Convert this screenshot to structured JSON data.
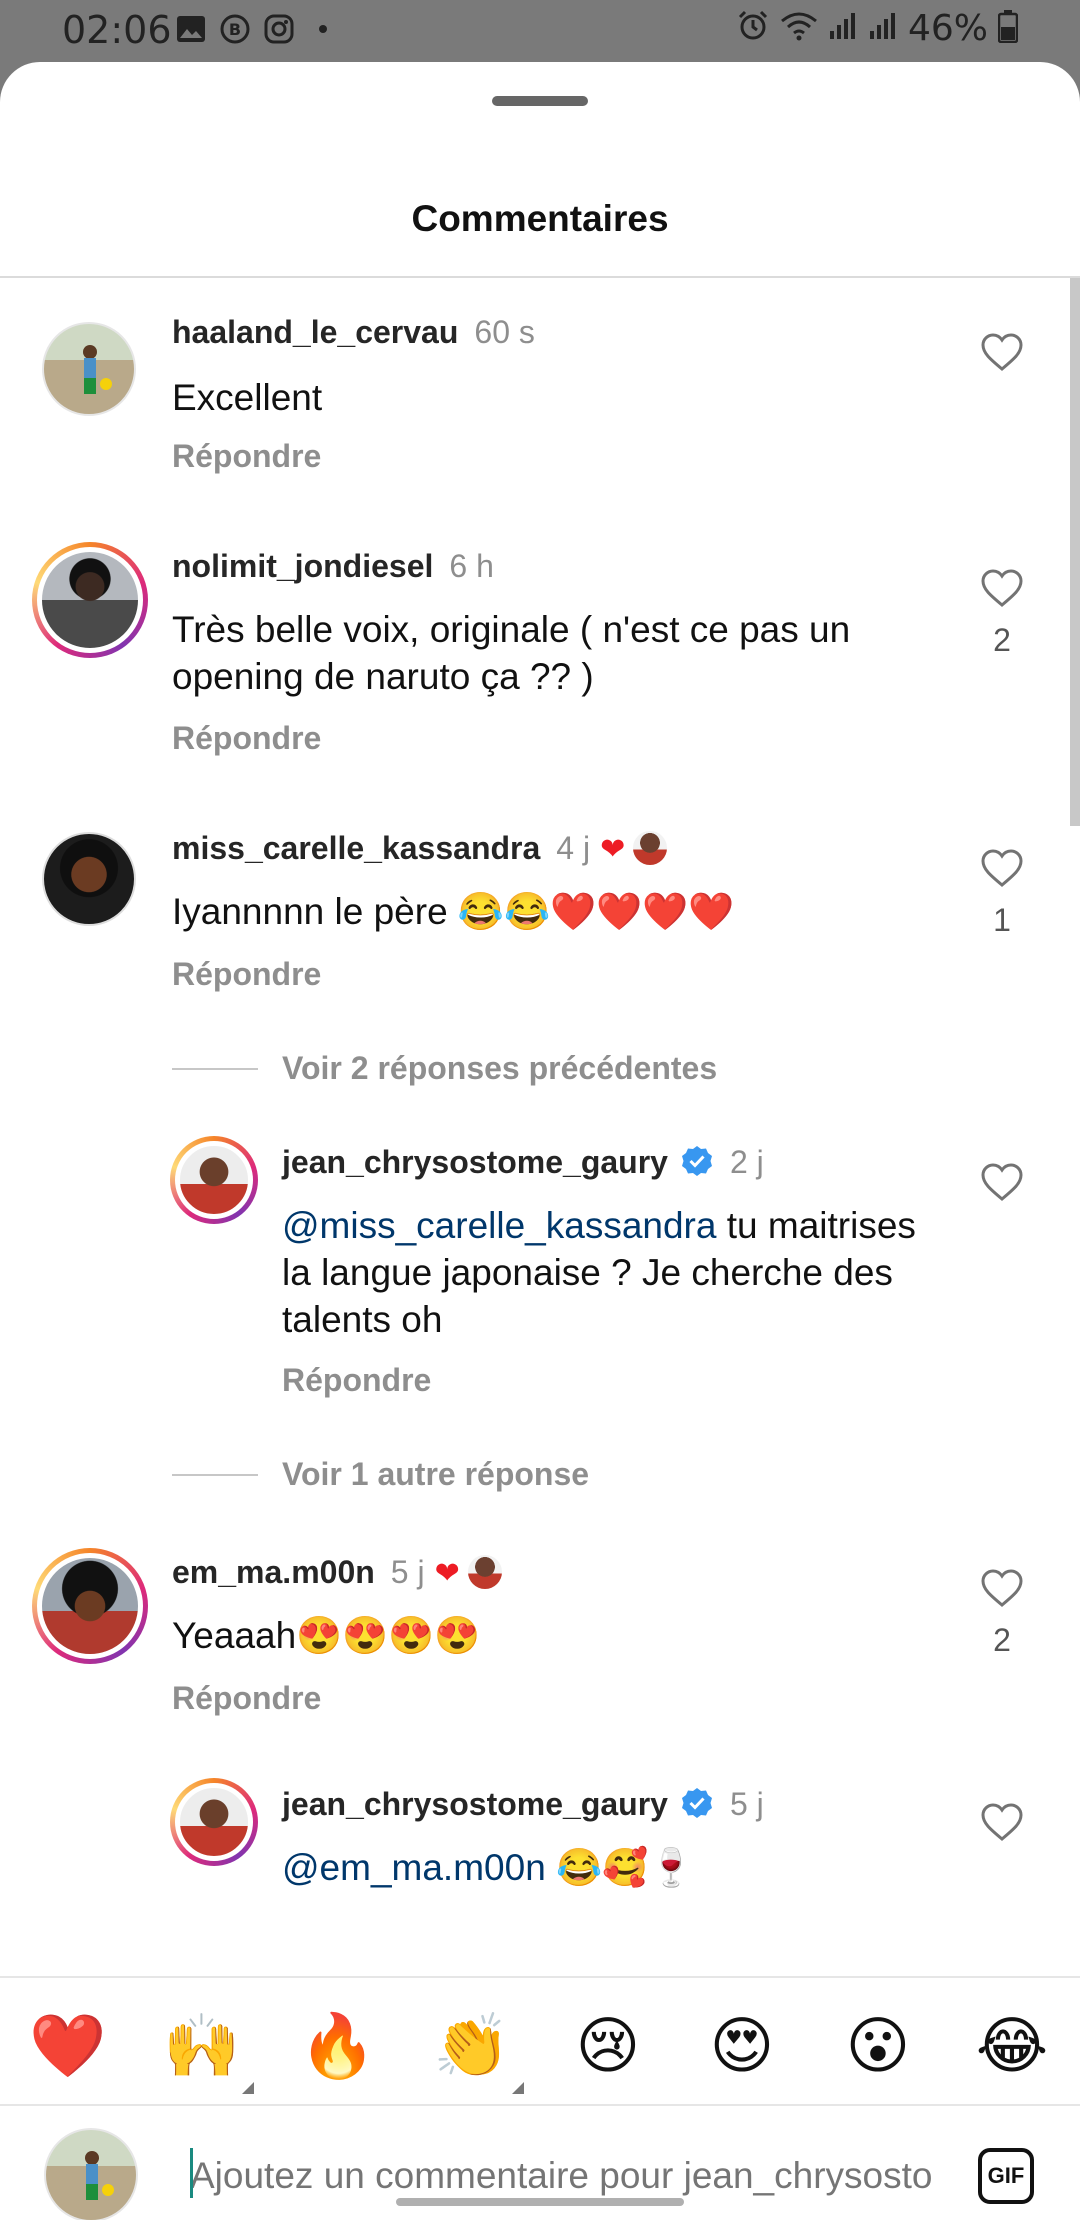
{
  "status_bar": {
    "time": "02:06",
    "battery": "46%",
    "left_icons": [
      "gallery-icon",
      "b-circle-icon",
      "instagram-icon",
      "dot-icon"
    ],
    "right_icons": [
      "alarm-icon",
      "wifi-icon",
      "signal-icon",
      "signal-icon",
      "battery-icon"
    ]
  },
  "sheet": {
    "title": "Commentaires"
  },
  "comments": [
    {
      "username": "haaland_le_cervau",
      "time": "60 s",
      "text": "Excellent",
      "reply": "Répondre",
      "likes": ""
    },
    {
      "username": "nolimit_jondiesel",
      "time": "6 h",
      "text": "Très belle voix, originale ( n'est ce pas un opening de naruto ça ?? )",
      "reply": "Répondre",
      "likes": "2"
    },
    {
      "username": "miss_carelle_kassandra",
      "time": "4 j",
      "creator_liked": "❤",
      "text": "Iyannnnn le père 😂😂❤️❤️❤️❤️",
      "reply": "Répondre",
      "likes": "1"
    },
    {
      "username": "em_ma.m00n",
      "time": "5 j",
      "creator_liked": "❤",
      "text": "Yeaaah😍😍😍😍",
      "reply": "Répondre",
      "likes": "2"
    }
  ],
  "threads": {
    "view_prev": "Voir 2 réponses précédentes",
    "reply1": {
      "username": "jean_chrysostome_gaury",
      "time": "2 j",
      "mention": "@miss_carelle_kassandra",
      "text": " tu maitrises la langue japonaise ? Je cherche des talents oh",
      "reply": "Répondre"
    },
    "view_more": "Voir 1 autre réponse",
    "reply2": {
      "username": "jean_chrysostome_gaury",
      "time": "5 j",
      "mention": "@em_ma.m00n",
      "text": " 😂🥰🍷"
    }
  },
  "emoji_bar": [
    "❤️",
    "🙌",
    "🔥",
    "👏",
    "😢",
    "😍",
    "😮",
    "😂"
  ],
  "composer": {
    "placeholder": "Ajoutez un commentaire pour jean_chrysostome_gaury...",
    "gif_label": "GIF"
  },
  "colors": {
    "mention": "#00376b",
    "secondary_text": "#8e8e8e",
    "verified": "#3897f0"
  }
}
